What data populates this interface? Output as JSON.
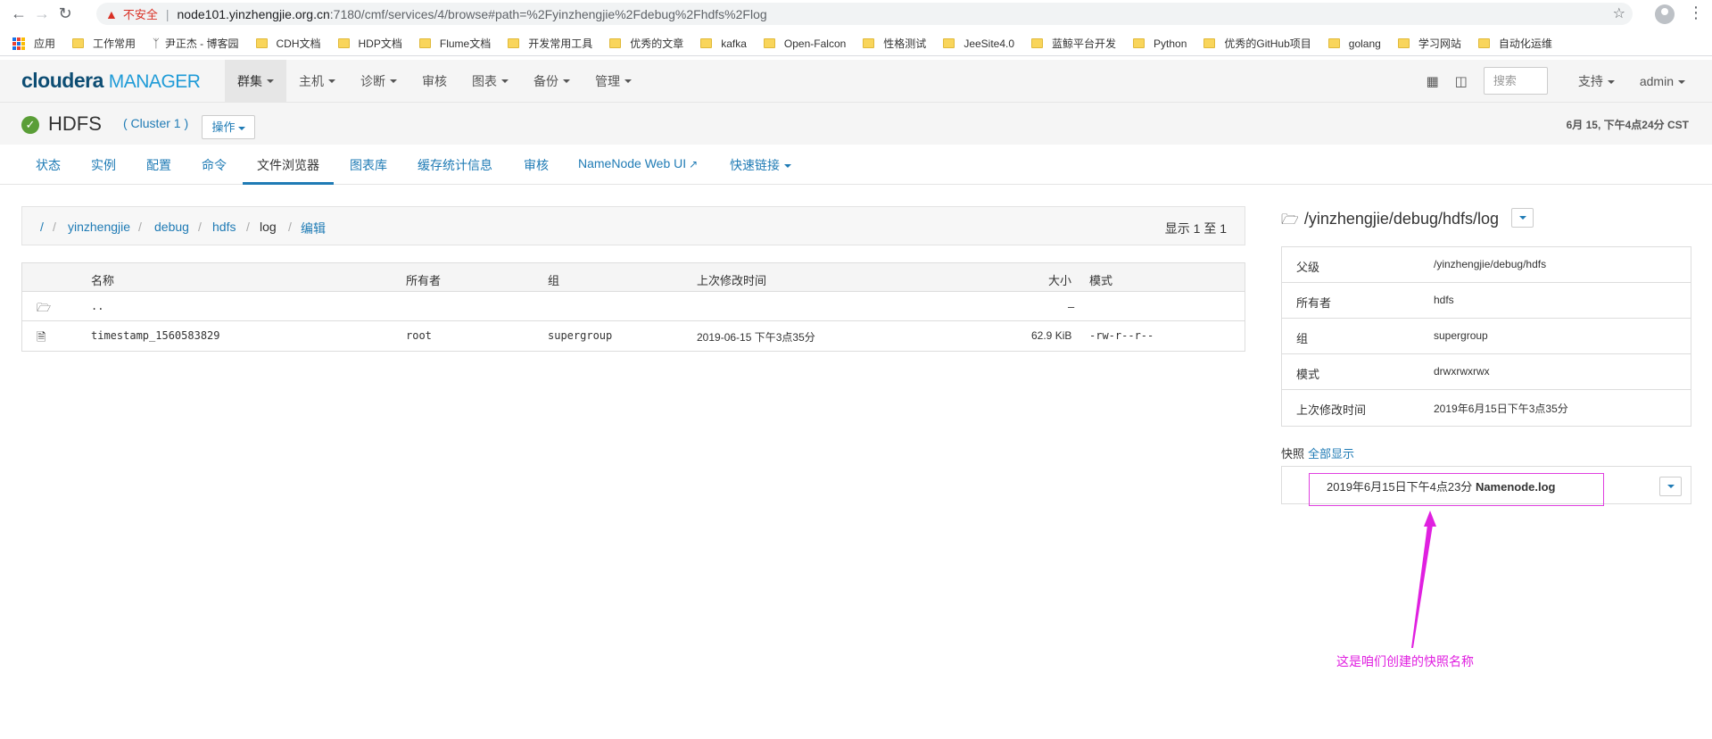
{
  "browser": {
    "security_label": "不安全",
    "url_host": "node101.yinzhengjie.org.cn",
    "url_rest": ":7180/cmf/services/4/browse#path=%2Fyinzhengjie%2Fdebug%2Fhdfs%2Flog",
    "bookmarks": [
      {
        "label": "应用",
        "icon": "apps-grid-icon"
      },
      {
        "label": "工作常用",
        "icon": "folder-icon"
      },
      {
        "label": "尹正杰 - 博客园",
        "icon": "blog-icon"
      },
      {
        "label": "CDH文档",
        "icon": "folder-icon"
      },
      {
        "label": "HDP文档",
        "icon": "folder-icon"
      },
      {
        "label": "Flume文档",
        "icon": "folder-icon"
      },
      {
        "label": "开发常用工具",
        "icon": "folder-icon"
      },
      {
        "label": "优秀的文章",
        "icon": "folder-icon"
      },
      {
        "label": "kafka",
        "icon": "folder-icon"
      },
      {
        "label": "Open-Falcon",
        "icon": "folder-icon"
      },
      {
        "label": "性格测试",
        "icon": "folder-icon"
      },
      {
        "label": "JeeSite4.0",
        "icon": "folder-icon"
      },
      {
        "label": "蓝鲸平台开发",
        "icon": "folder-icon"
      },
      {
        "label": "Python",
        "icon": "folder-icon"
      },
      {
        "label": "优秀的GitHub项目",
        "icon": "folder-icon"
      },
      {
        "label": "golang",
        "icon": "folder-icon"
      },
      {
        "label": "学习网站",
        "icon": "folder-icon"
      },
      {
        "label": "自动化运维",
        "icon": "folder-icon"
      }
    ]
  },
  "cm": {
    "logo_main": "cloudera",
    "logo_sub": "MANAGER",
    "menu": [
      "群集",
      "主机",
      "诊断",
      "审核",
      "图表",
      "备份",
      "管理"
    ],
    "search_placeholder": "搜索",
    "support": "支持",
    "user": "admin"
  },
  "service": {
    "name": "HDFS",
    "cluster": "( Cluster 1 )",
    "actions": "操作",
    "time": "6月 15, 下午4点24分 CST",
    "tabs": [
      "状态",
      "实例",
      "配置",
      "命令",
      "文件浏览器",
      "图表库",
      "缓存统计信息",
      "审核",
      "NameNode Web UI",
      "快速链接"
    ]
  },
  "browser_panel": {
    "crumbs": [
      "/",
      "yinzhengjie",
      "debug",
      "hdfs",
      "log",
      "编辑"
    ],
    "count": "显示 1 至 1",
    "columns": [
      "名称",
      "所有者",
      "组",
      "上次修改时间",
      "大小",
      "模式"
    ],
    "rows": [
      {
        "name": "..",
        "owner": "",
        "group": "",
        "modified": "",
        "size": "–",
        "mode": ""
      },
      {
        "name": "timestamp_1560583829",
        "owner": "root",
        "group": "supergroup",
        "modified": "2019-06-15 下午3点35分",
        "size": "62.9 KiB",
        "mode": "-rw-r--r--"
      }
    ]
  },
  "info": {
    "path": "/yinzhengjie/debug/hdfs/log",
    "rows": [
      {
        "key": "父级",
        "value": "/yinzhengjie/debug/hdfs"
      },
      {
        "key": "所有者",
        "value": "hdfs"
      },
      {
        "key": "组",
        "value": "supergroup"
      },
      {
        "key": "模式",
        "value": "drwxrwxrwx"
      },
      {
        "key": "上次修改时间",
        "value": "2019年6月15日下午3点35分"
      }
    ],
    "snap_label": "快照",
    "snap_all": "全部显示",
    "snapshot_time": "2019年6月15日下午4点23分",
    "snapshot_name": "Namenode.log"
  },
  "annotation": {
    "text": "这是咱们创建的快照名称",
    "color": "#e020e0"
  }
}
